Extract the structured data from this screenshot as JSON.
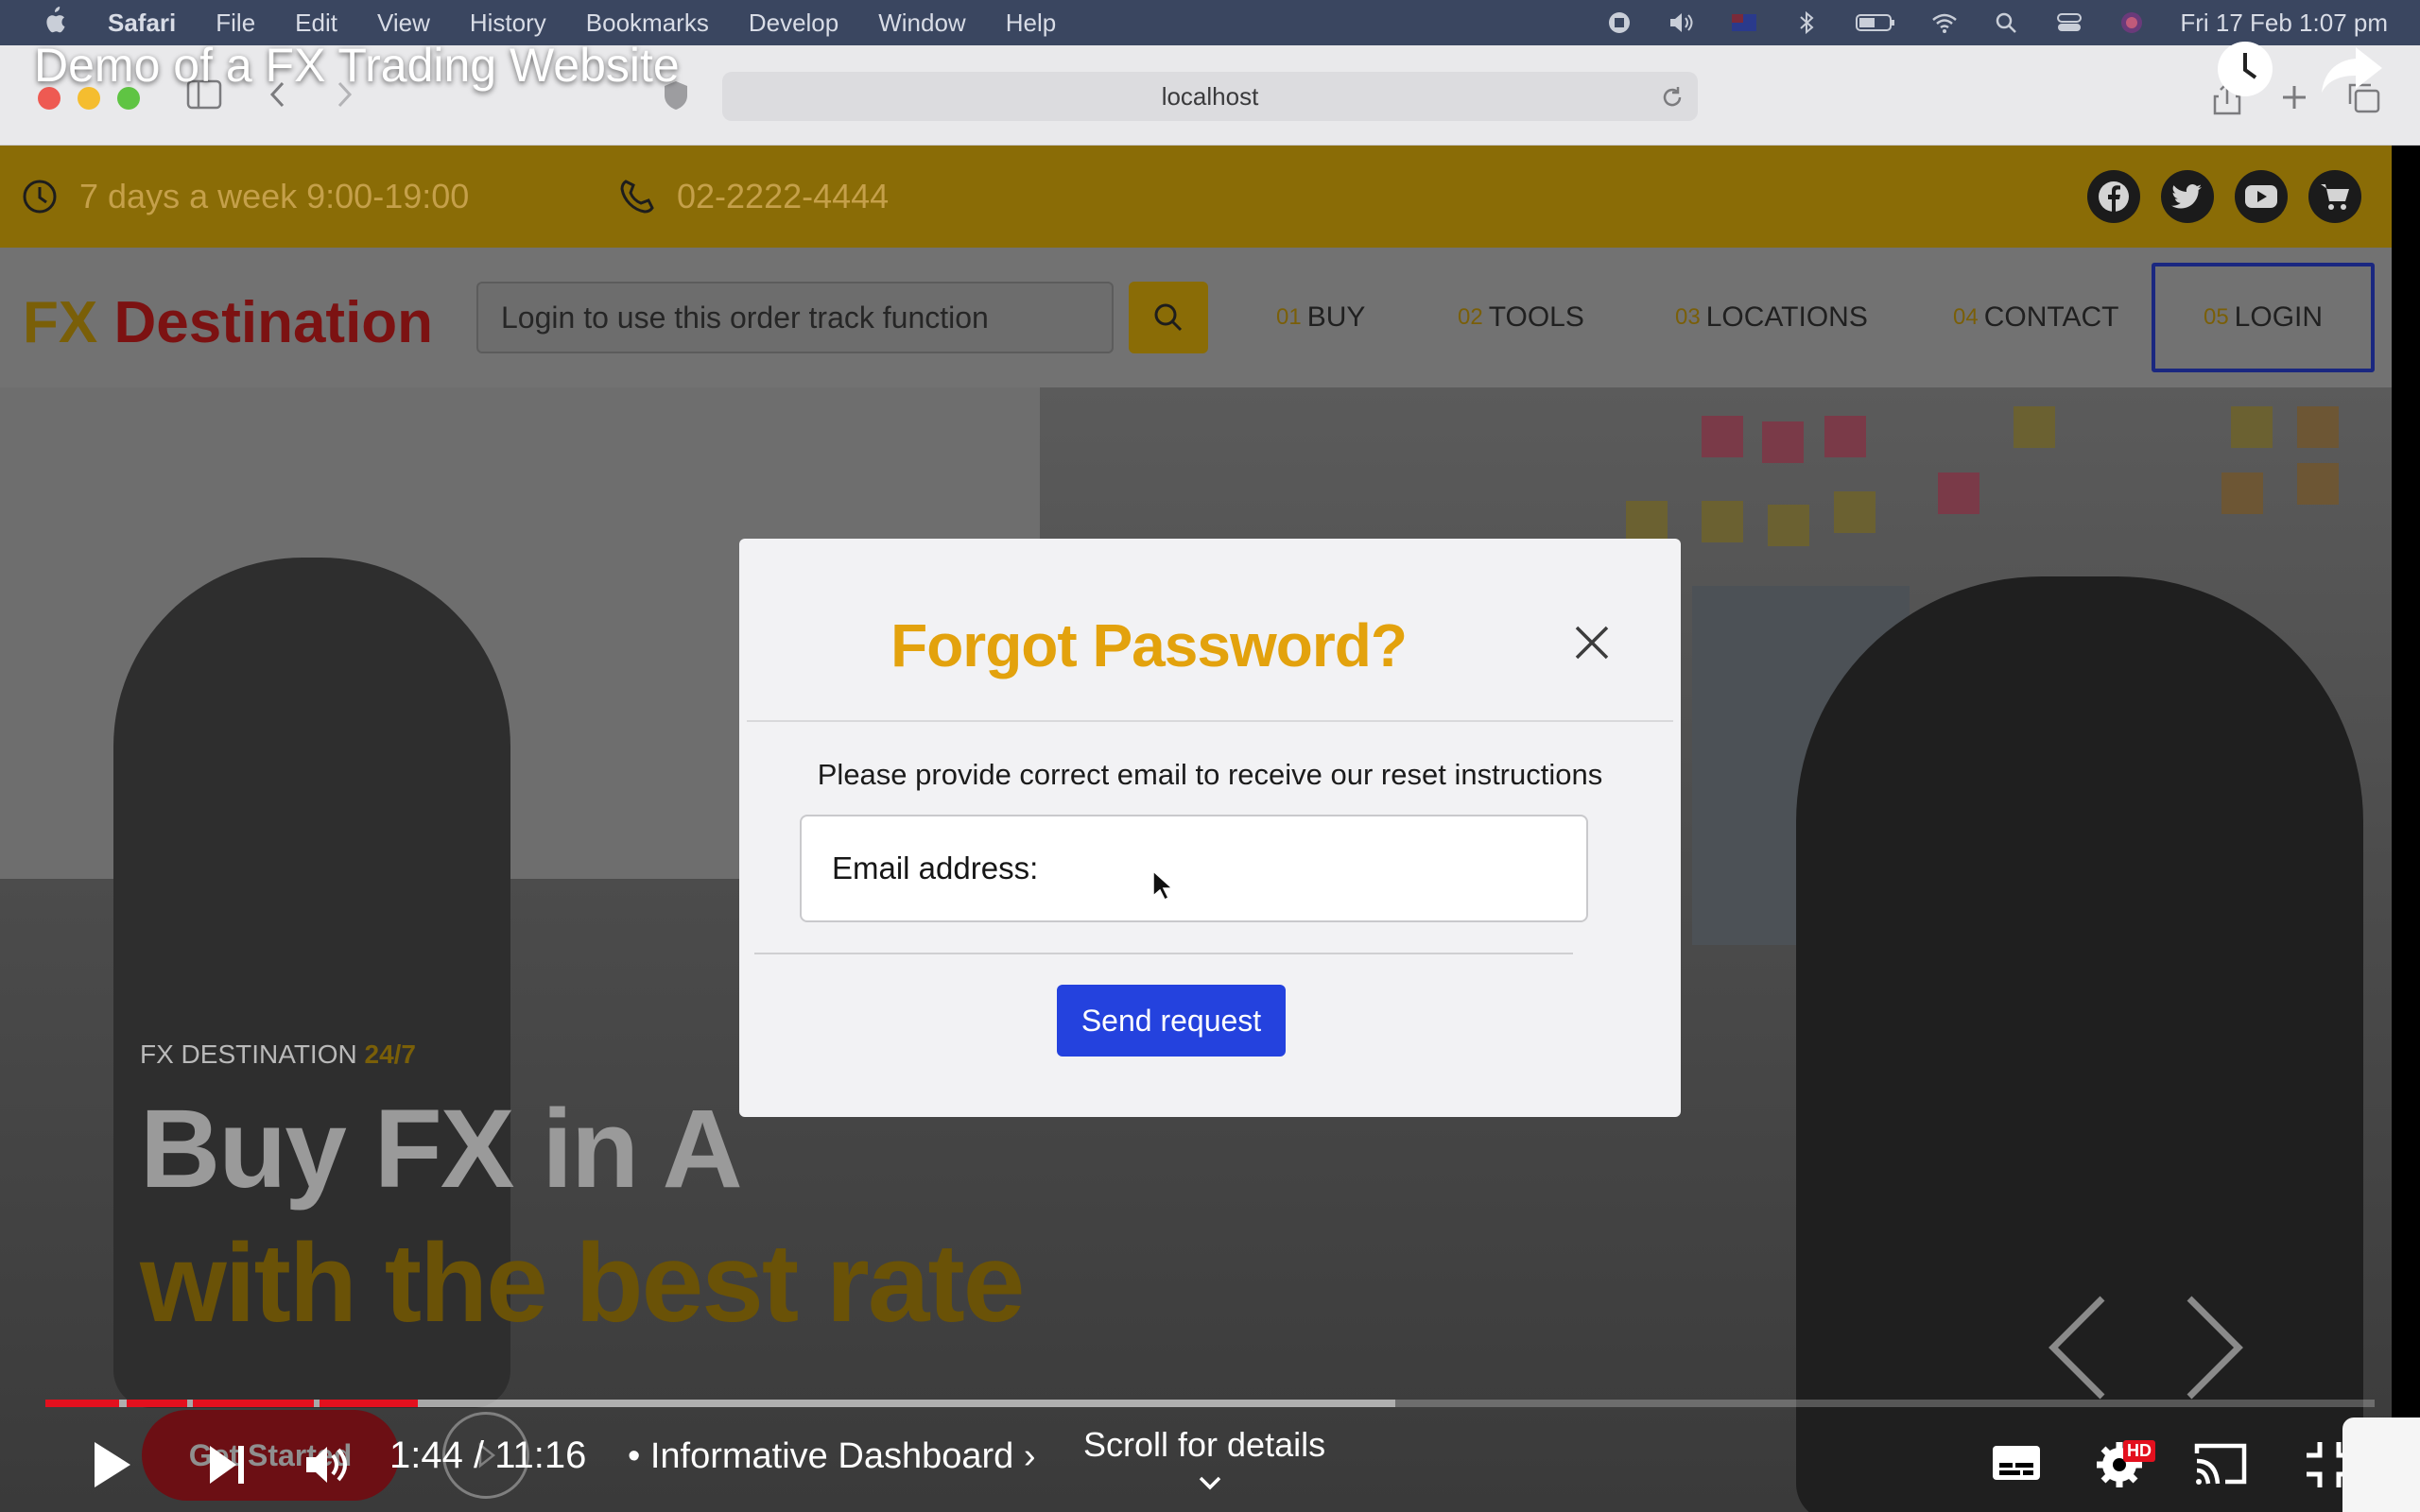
{
  "menubar": {
    "app": "Safari",
    "items": [
      "File",
      "Edit",
      "View",
      "History",
      "Bookmarks",
      "Develop",
      "Window",
      "Help"
    ],
    "clock": "Fri 17 Feb  1:07 pm"
  },
  "browser": {
    "url": "localhost",
    "video_title": "Demo of a FX Trading Website"
  },
  "site": {
    "hours": "7 days a week 9:00-19:00",
    "phone": "02-2222-4444",
    "logo_fx": "FX",
    "logo_dest": "Destination",
    "track_placeholder": "Login to use this order track function",
    "nav": [
      {
        "num": "01",
        "label": "BUY"
      },
      {
        "num": "02",
        "label": "TOOLS"
      },
      {
        "num": "03",
        "label": "LOCATIONS"
      },
      {
        "num": "04",
        "label": "CONTACT"
      },
      {
        "num": "05",
        "label": "LOGIN"
      }
    ],
    "hero": {
      "kicker": "FX DESTINATION",
      "kicker_highlight": "24/7",
      "line1": "Buy FX in A",
      "line2": "with the best rate",
      "cta": "Get Started"
    }
  },
  "modal": {
    "title": "Forgot Password?",
    "description": "Please provide correct email to receive our reset instructions",
    "email_label": "Email address:",
    "submit": "Send request"
  },
  "player": {
    "time": "1:44 / 11:16",
    "chapter": "• Informative Dashboard",
    "scroll_hint": "Scroll for details",
    "progress_fraction": 0.1563,
    "buffered_fraction": 0.58
  },
  "colors": {
    "accent_gold": "#e3a20d",
    "primary_button": "#2442de",
    "youtube_red": "#e3101e"
  }
}
